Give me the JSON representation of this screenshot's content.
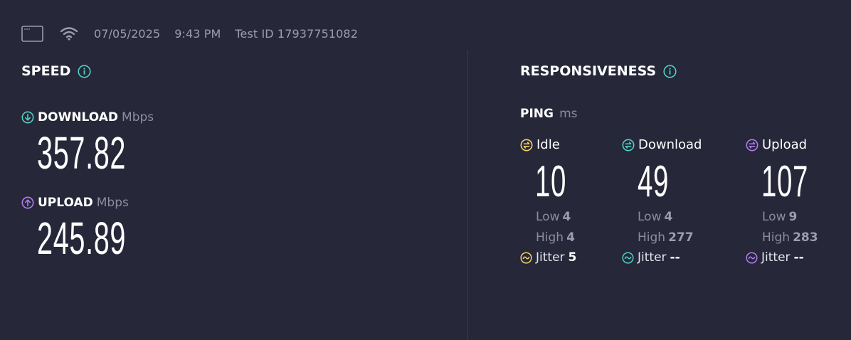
{
  "colors": {
    "background": "#262738",
    "download_accent": "#4fd1c5",
    "upload_accent": "#b07cf0",
    "idle_accent": "#f2d36b",
    "muted_text": "#8c8da0"
  },
  "meta": {
    "date": "07/05/2025",
    "time": "9:43 PM",
    "test_id": "Test ID 17937751082",
    "icons": [
      "window-icon",
      "wifi-icon"
    ]
  },
  "speed": {
    "title": "SPEED",
    "download": {
      "label": "DOWNLOAD",
      "unit": "Mbps",
      "value": "357.82",
      "icon": "arrow-down-circle-icon"
    },
    "upload": {
      "label": "UPLOAD",
      "unit": "Mbps",
      "value": "245.89",
      "icon": "arrow-up-circle-icon"
    }
  },
  "responsiveness": {
    "title": "RESPONSIVENESS",
    "ping_label": "PING",
    "ping_unit": "ms",
    "columns": [
      {
        "name": "Idle",
        "value": "10",
        "low_label": "Low",
        "low": "4",
        "high_label": "High",
        "high": "4",
        "jitter_label": "Jitter",
        "jitter": "5"
      },
      {
        "name": "Download",
        "value": "49",
        "low_label": "Low",
        "low": "4",
        "high_label": "High",
        "high": "277",
        "jitter_label": "Jitter",
        "jitter": "--"
      },
      {
        "name": "Upload",
        "value": "107",
        "low_label": "Low",
        "low": "9",
        "high_label": "High",
        "high": "283",
        "jitter_label": "Jitter",
        "jitter": "--"
      }
    ]
  }
}
